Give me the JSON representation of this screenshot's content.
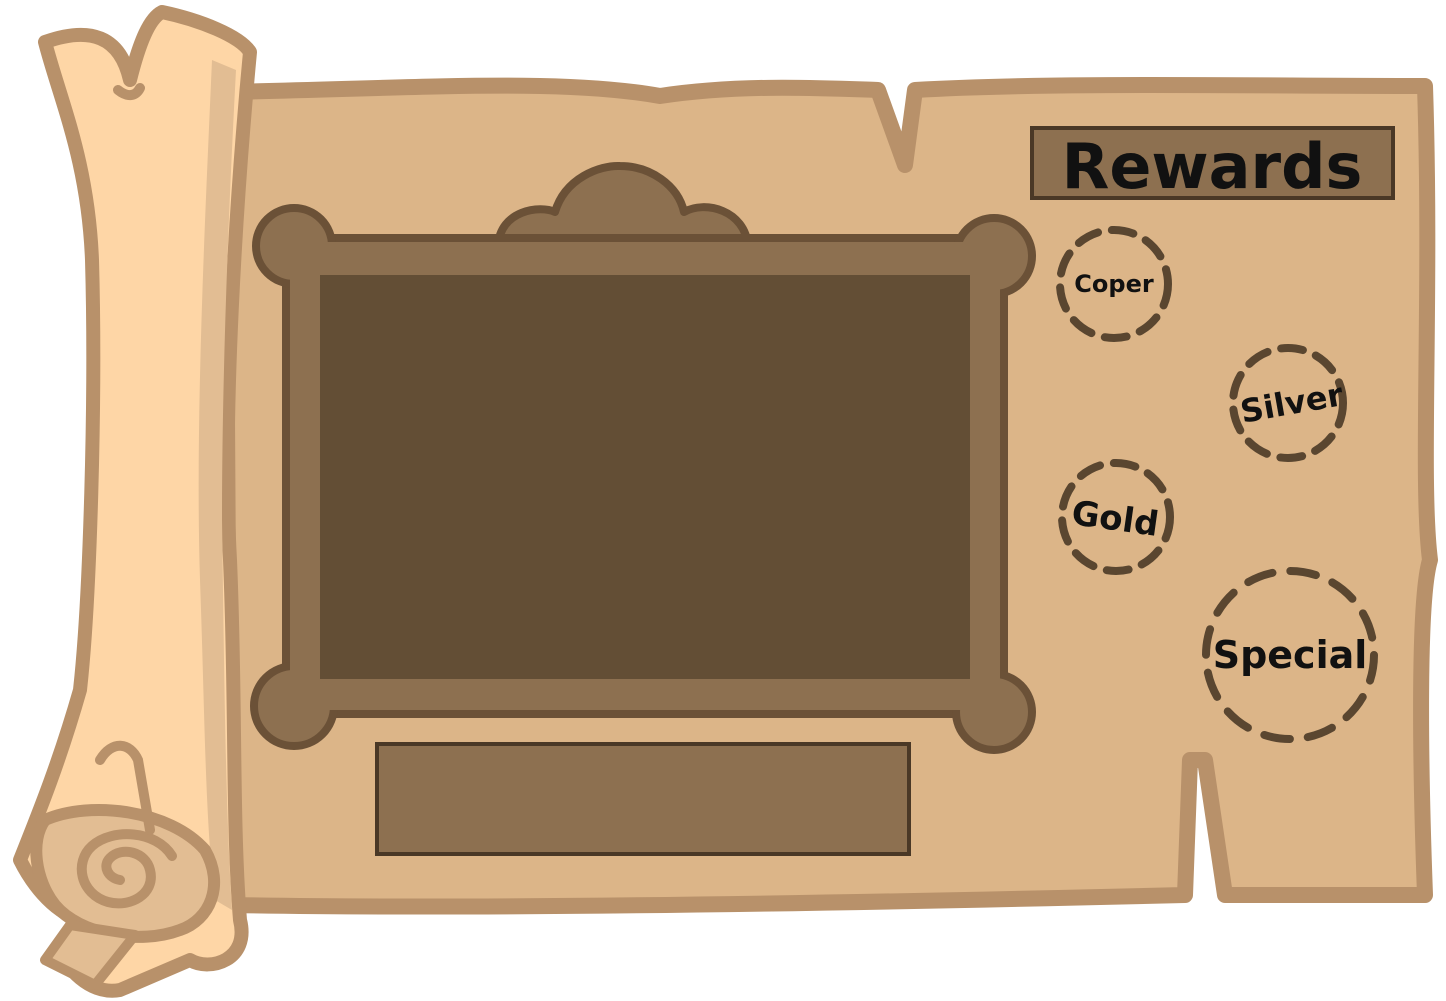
{
  "panel": {
    "title": "Rewards"
  },
  "reward_slots": [
    {
      "id": "coper",
      "label": "Coper"
    },
    {
      "id": "silver",
      "label": "Silver"
    },
    {
      "id": "gold",
      "label": "Gold"
    },
    {
      "id": "special",
      "label": "Special"
    }
  ],
  "colors": {
    "parchment": "#dcb588",
    "parchment_outline": "#b8916a",
    "scroll_light": "#fed6a6",
    "scroll_mid": "#e2bd93",
    "frame": "#8d7050",
    "frame_outline": "#6b5137",
    "screen": "#634e35",
    "banner": "#8d7050",
    "dash": "#5a4630",
    "text": "#111111"
  },
  "icons": {
    "scroll_rod": "wooden-scroll-rod",
    "spiral": "spiral-knot-icon"
  }
}
